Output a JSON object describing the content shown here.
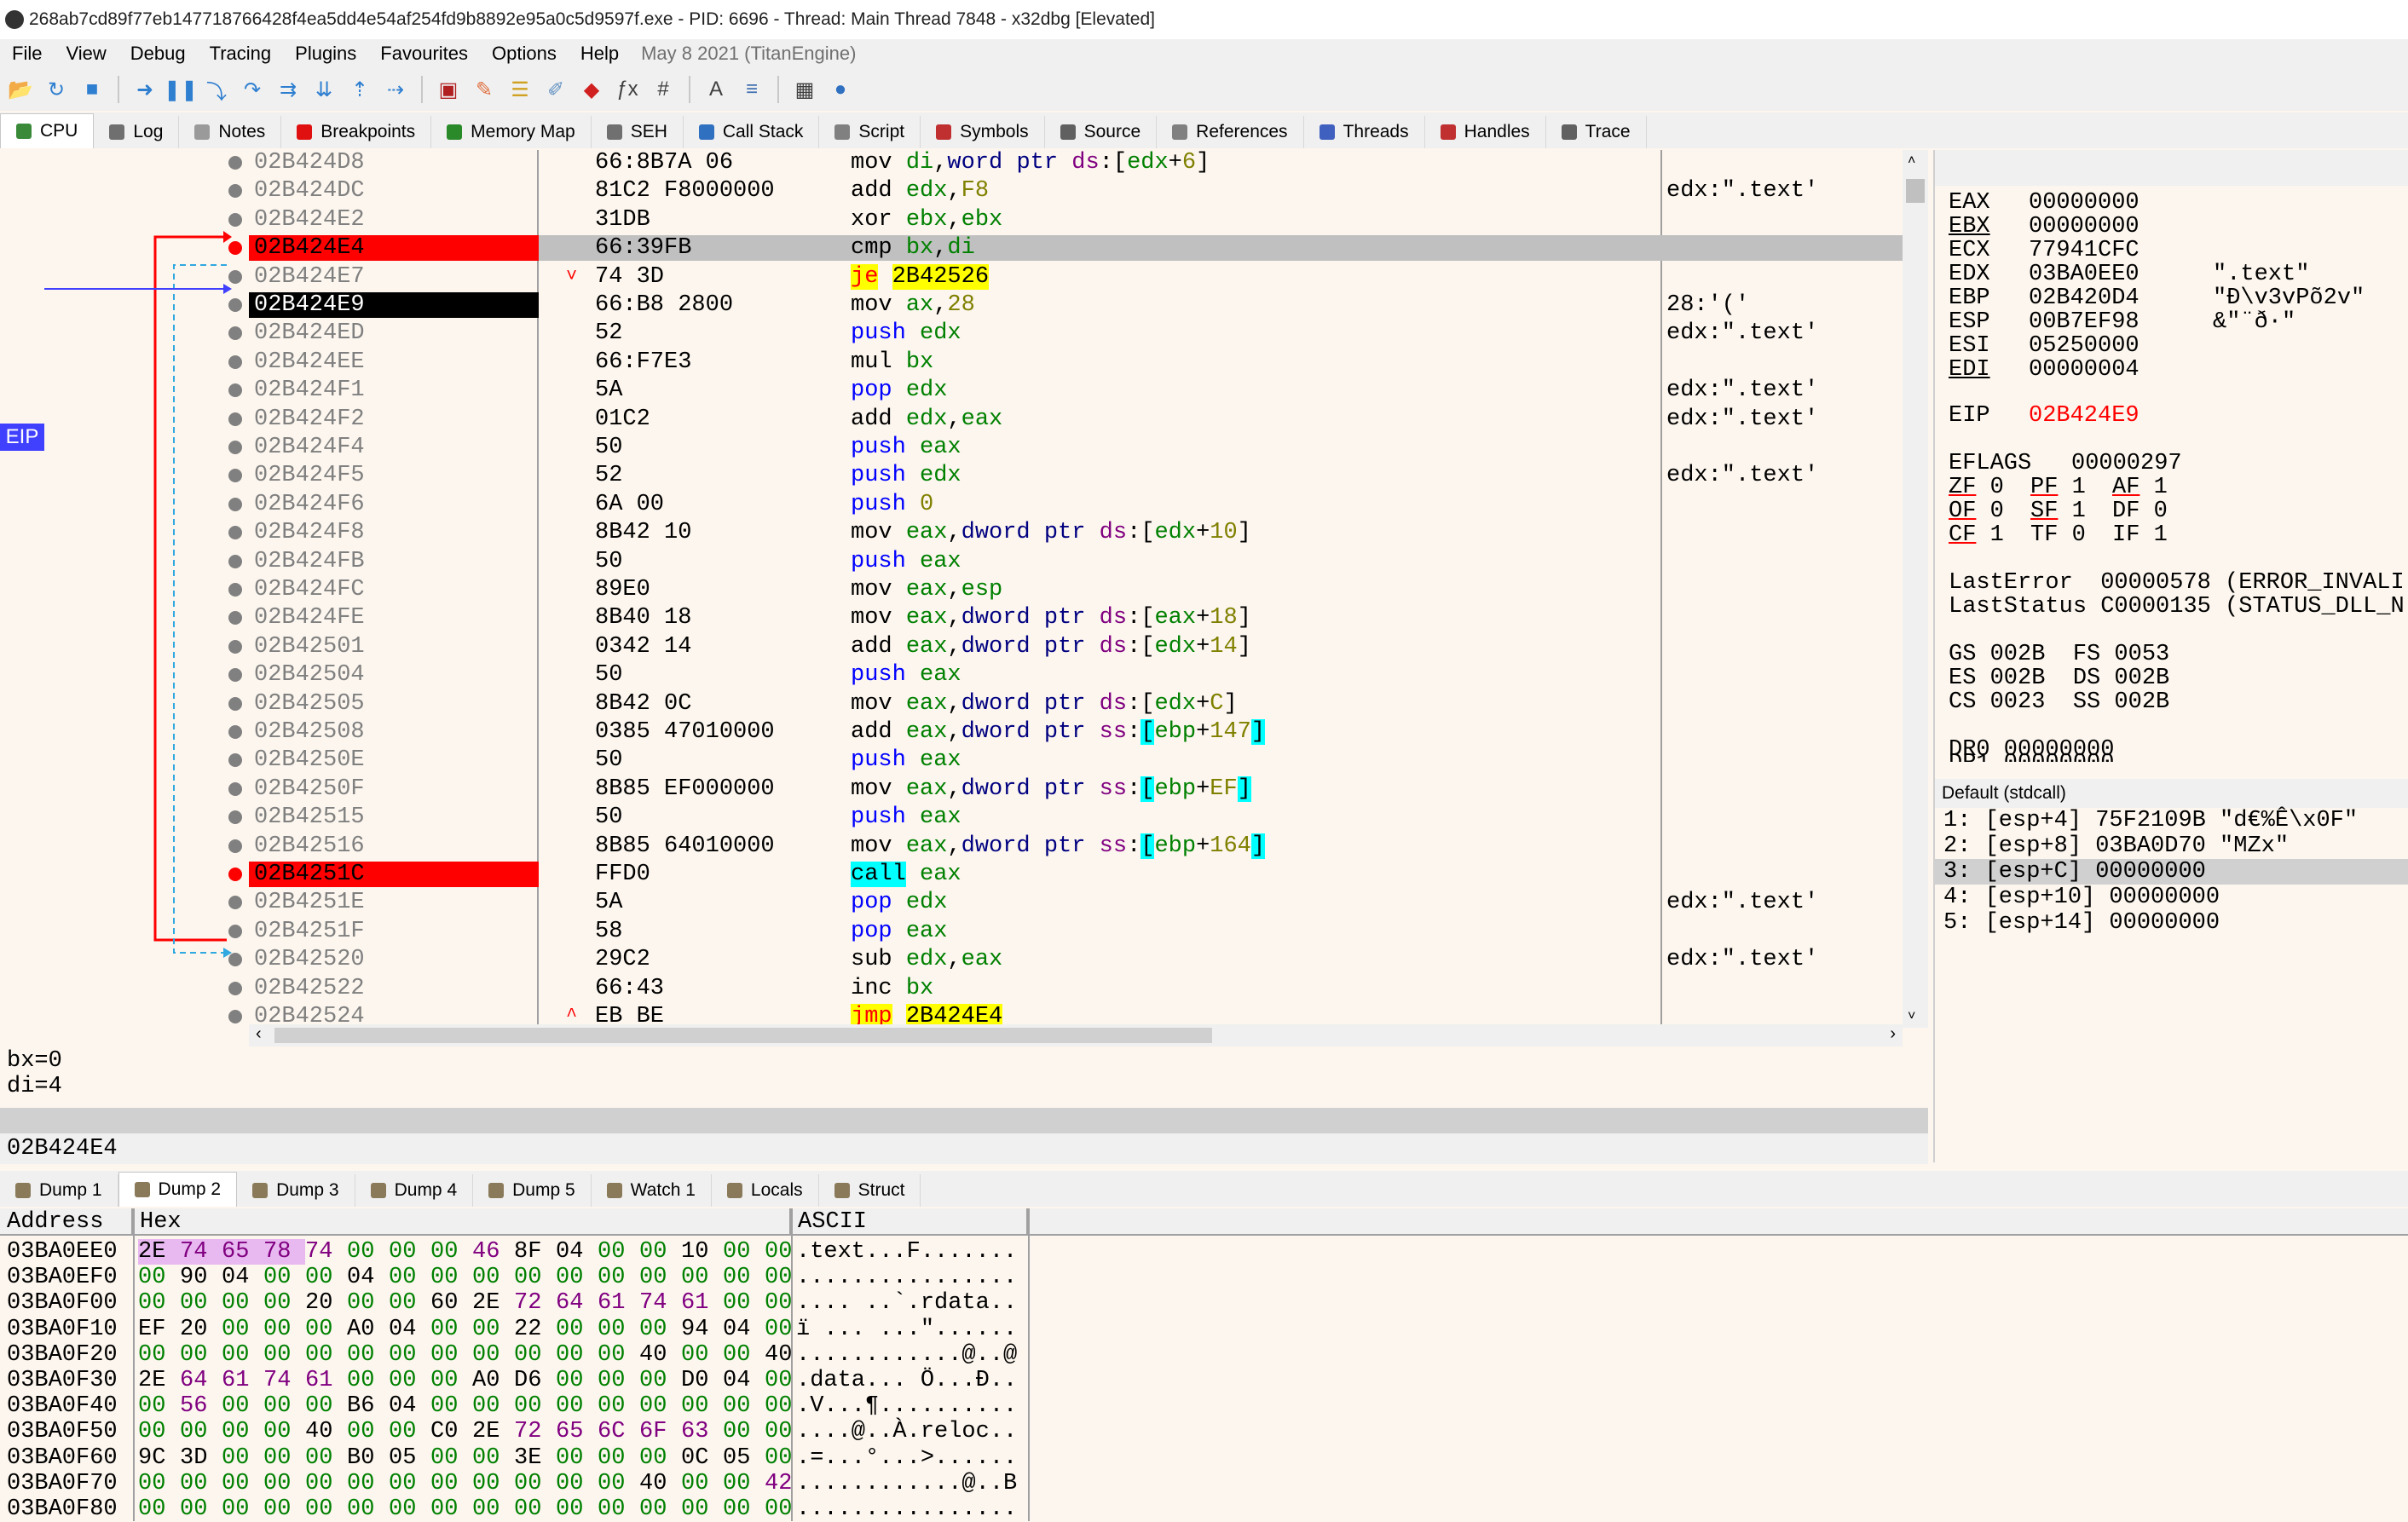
{
  "window": {
    "title": "268ab7cd89f77eb147718766428f4ea5dd4e54af254fd9b8892e95a0c5d9597f.exe - PID: 6696 - Thread: Main Thread 7848 - x32dbg [Elevated]"
  },
  "menu": {
    "items": [
      "File",
      "View",
      "Debug",
      "Tracing",
      "Plugins",
      "Favourites",
      "Options",
      "Help"
    ],
    "build": "May 8 2021 (TitanEngine)"
  },
  "toolbar": {
    "icons": [
      "open-icon",
      "restart-icon",
      "stop-icon",
      "run-icon",
      "pause-icon",
      "step-into-icon",
      "step-over-icon",
      "trace-into-icon",
      "trace-over-icon",
      "execute-till-return-icon",
      "run-to-user-code-icon",
      "scylla-icon",
      "patch-icon",
      "comments-icon",
      "labels-icon",
      "bookmarks-icon",
      "functions-icon",
      "variables-icon",
      "font-icon",
      "strings-icon",
      "calculator-icon",
      "help-icon"
    ]
  },
  "tabs": [
    {
      "label": "CPU",
      "icon": "cpu-icon",
      "color": "#3a8a3a"
    },
    {
      "label": "Log",
      "icon": "log-icon",
      "color": "#6f6f6f"
    },
    {
      "label": "Notes",
      "icon": "notes-icon",
      "color": "#9a9a9a"
    },
    {
      "label": "Breakpoints",
      "icon": "breakpoint-icon",
      "color": "#e01010"
    },
    {
      "label": "Memory Map",
      "icon": "memory-map-icon",
      "color": "#2a8a2a"
    },
    {
      "label": "SEH",
      "icon": "seh-icon",
      "color": "#707070"
    },
    {
      "label": "Call Stack",
      "icon": "call-stack-icon",
      "color": "#3070c0"
    },
    {
      "label": "Script",
      "icon": "script-icon",
      "color": "#808080"
    },
    {
      "label": "Symbols",
      "icon": "symbols-icon",
      "color": "#c03030"
    },
    {
      "label": "Source",
      "icon": "source-icon",
      "color": "#606060"
    },
    {
      "label": "References",
      "icon": "references-icon",
      "color": "#808080"
    },
    {
      "label": "Threads",
      "icon": "threads-icon",
      "color": "#4060c0"
    },
    {
      "label": "Handles",
      "icon": "handles-icon",
      "color": "#c03030"
    },
    {
      "label": "Trace",
      "icon": "trace-icon",
      "color": "#606060"
    }
  ],
  "eip_label": "EIP",
  "disasm": [
    {
      "addr": "02B424D8",
      "bytes": "66:8B7A 06",
      "instr": "mov di,word ptr ds:[edx+6]",
      "comment": ""
    },
    {
      "addr": "02B424DC",
      "bytes": "81C2 F8000000",
      "instr": "add edx,F8",
      "comment": "edx:\".text'"
    },
    {
      "addr": "02B424E2",
      "bytes": "31DB",
      "instr": "xor ebx,ebx",
      "comment": ""
    },
    {
      "addr": "02B424E4",
      "bytes": "66:39FB",
      "instr": "cmp bx,di",
      "comment": "",
      "bp": true,
      "selected": true
    },
    {
      "addr": "02B424E7",
      "bytes": "74 3D",
      "instr": "je 2B42526",
      "comment": "",
      "jmark": "˅",
      "jcc": true
    },
    {
      "addr": "02B424E9",
      "bytes": "66:B8 2800",
      "instr": "mov ax,28",
      "comment": "28:'('",
      "eip": true
    },
    {
      "addr": "02B424ED",
      "bytes": "52",
      "instr": "push edx",
      "comment": "edx:\".text'"
    },
    {
      "addr": "02B424EE",
      "bytes": "66:F7E3",
      "instr": "mul bx",
      "comment": ""
    },
    {
      "addr": "02B424F1",
      "bytes": "5A",
      "instr": "pop edx",
      "comment": "edx:\".text'"
    },
    {
      "addr": "02B424F2",
      "bytes": "01C2",
      "instr": "add edx,eax",
      "comment": "edx:\".text'"
    },
    {
      "addr": "02B424F4",
      "bytes": "50",
      "instr": "push eax",
      "comment": ""
    },
    {
      "addr": "02B424F5",
      "bytes": "52",
      "instr": "push edx",
      "comment": "edx:\".text'"
    },
    {
      "addr": "02B424F6",
      "bytes": "6A 00",
      "instr": "push 0",
      "comment": ""
    },
    {
      "addr": "02B424F8",
      "bytes": "8B42 10",
      "instr": "mov eax,dword ptr ds:[edx+10]",
      "comment": ""
    },
    {
      "addr": "02B424FB",
      "bytes": "50",
      "instr": "push eax",
      "comment": ""
    },
    {
      "addr": "02B424FC",
      "bytes": "89E0",
      "instr": "mov eax,esp",
      "comment": ""
    },
    {
      "addr": "02B424FE",
      "bytes": "8B40 18",
      "instr": "mov eax,dword ptr ds:[eax+18]",
      "comment": ""
    },
    {
      "addr": "02B42501",
      "bytes": "0342 14",
      "instr": "add eax,dword ptr ds:[edx+14]",
      "comment": ""
    },
    {
      "addr": "02B42504",
      "bytes": "50",
      "instr": "push eax",
      "comment": ""
    },
    {
      "addr": "02B42505",
      "bytes": "8B42 0C",
      "instr": "mov eax,dword ptr ds:[edx+C]",
      "comment": ""
    },
    {
      "addr": "02B42508",
      "bytes": "0385 47010000",
      "instr": "add eax,dword ptr ss:[ebp+147]",
      "comment": ""
    },
    {
      "addr": "02B4250E",
      "bytes": "50",
      "instr": "push eax",
      "comment": ""
    },
    {
      "addr": "02B4250F",
      "bytes": "8B85 EF000000",
      "instr": "mov eax,dword ptr ss:[ebp+EF]",
      "comment": ""
    },
    {
      "addr": "02B42515",
      "bytes": "50",
      "instr": "push eax",
      "comment": ""
    },
    {
      "addr": "02B42516",
      "bytes": "8B85 64010000",
      "instr": "mov eax,dword ptr ss:[ebp+164]",
      "comment": ""
    },
    {
      "addr": "02B4251C",
      "bytes": "FFD0",
      "instr": "call eax",
      "comment": "",
      "bp": true,
      "call": true
    },
    {
      "addr": "02B4251E",
      "bytes": "5A",
      "instr": "pop edx",
      "comment": "edx:\".text'"
    },
    {
      "addr": "02B4251F",
      "bytes": "58",
      "instr": "pop eax",
      "comment": ""
    },
    {
      "addr": "02B42520",
      "bytes": "29C2",
      "instr": "sub edx,eax",
      "comment": "edx:\".text'"
    },
    {
      "addr": "02B42522",
      "bytes": "66:43",
      "instr": "inc bx",
      "comment": ""
    },
    {
      "addr": "02B42524",
      "bytes": "EB BE",
      "instr": "jmp 2B424E4",
      "comment": "",
      "jmark": "^",
      "jcc": true
    },
    {
      "addr": "02B42526",
      "bytes": "6A 00",
      "instr": "push 0",
      "comment": ""
    },
    {
      "addr": "02B42528",
      "bytes": "6A 04",
      "instr": "push 4",
      "comment": ""
    },
    {
      "addr": "02B4252A",
      "bytes": "89E0",
      "instr": "mov eax,esp",
      "comment": ""
    }
  ],
  "registers": {
    "general": [
      {
        "name": "EAX",
        "value": "00000000",
        "extra": ""
      },
      {
        "name": "EBX",
        "value": "00000000",
        "extra": "",
        "style": "uline"
      },
      {
        "name": "ECX",
        "value": "77941CFC",
        "extra": ""
      },
      {
        "name": "EDX",
        "value": "03BA0EE0",
        "extra": "\".text\""
      },
      {
        "name": "EBP",
        "value": "02B420D4",
        "extra": "\"Đ\\v3vPõ2v\""
      },
      {
        "name": "ESP",
        "value": "00B7EF98",
        "extra": "&\"¨ð·\""
      },
      {
        "name": "ESI",
        "value": "05250000",
        "extra": ""
      },
      {
        "name": "EDI",
        "value": "00000004",
        "extra": "",
        "style": "uline"
      }
    ],
    "eip": {
      "name": "EIP",
      "value": "02B424E9"
    },
    "eflags": {
      "name": "EFLAGS",
      "value": "00000297"
    },
    "flags_rows": [
      [
        {
          "n": "ZF",
          "v": "0",
          "u": "ured"
        },
        {
          "n": "PF",
          "v": "1",
          "u": "ured"
        },
        {
          "n": "AF",
          "v": "1",
          "u": "ured"
        }
      ],
      [
        {
          "n": "OF",
          "v": "0",
          "u": "ured"
        },
        {
          "n": "SF",
          "v": "1",
          "u": "ured"
        },
        {
          "n": "DF",
          "v": "0",
          "u": ""
        }
      ],
      [
        {
          "n": "CF",
          "v": "1",
          "u": "ured"
        },
        {
          "n": "TF",
          "v": "0",
          "u": ""
        },
        {
          "n": "IF",
          "v": "1",
          "u": ""
        }
      ]
    ],
    "last_error": "LastError  00000578 (ERROR_INVALI",
    "last_status": "LastStatus C0000135 (STATUS_DLL_N",
    "segments": [
      "GS 002B  FS 0053",
      "ES 002B  DS 002B",
      "CS 0023  SS 002B"
    ],
    "dr0": "DR0 00000000",
    "dr1_partial": "DR1 00000000"
  },
  "args": {
    "header": "Default (stdcall)",
    "rows": [
      "1: [esp+4] 75F2109B \"d€%Ê\\x0F\"",
      "2: [esp+8] 03BA0D70 \"MZx\"",
      "3: [esp+C] 00000000",
      "4: [esp+10] 00000000",
      "5: [esp+14] 00000000"
    ],
    "selected_index": 2
  },
  "info": {
    "lines": [
      "bx=0",
      "di=4"
    ],
    "address": "02B424E4"
  },
  "dump_tabs": [
    {
      "label": "Dump 1",
      "icon": "dump-icon"
    },
    {
      "label": "Dump 2",
      "icon": "dump-icon"
    },
    {
      "label": "Dump 3",
      "icon": "dump-icon"
    },
    {
      "label": "Dump 4",
      "icon": "dump-icon"
    },
    {
      "label": "Dump 5",
      "icon": "dump-icon"
    },
    {
      "label": "Watch 1",
      "icon": "watch-icon"
    },
    {
      "label": "Locals",
      "icon": "locals-icon"
    },
    {
      "label": "Struct",
      "icon": "struct-icon"
    }
  ],
  "dump": {
    "headers": {
      "address": "Address",
      "hex": "Hex",
      "ascii": "ASCII"
    },
    "rows": [
      {
        "addr": "03BA0EE0",
        "hex": "2E 74 65 78 74 00 00 00 46 8F 04 00 00 10 00 00",
        "ascii": ".text...F......."
      },
      {
        "addr": "03BA0EF0",
        "hex": "00 90 04 00 00 04 00 00 00 00 00 00 00 00 00 00",
        "ascii": "................"
      },
      {
        "addr": "03BA0F00",
        "hex": "00 00 00 00 20 00 00 60 2E 72 64 61 74 61 00 00",
        "ascii": ".... ..`.rdata.."
      },
      {
        "addr": "03BA0F10",
        "hex": "EF 20 00 00 00 A0 04 00 00 22 00 00 00 94 04 00",
        "ascii": "ï ... ...\"......"
      },
      {
        "addr": "03BA0F20",
        "hex": "00 00 00 00 00 00 00 00 00 00 00 00 40 00 00 40",
        "ascii": "............@..@"
      },
      {
        "addr": "03BA0F30",
        "hex": "2E 64 61 74 61 00 00 00 A0 D6 00 00 00 D0 04 00",
        "ascii": ".data... Ö...Ð.."
      },
      {
        "addr": "03BA0F40",
        "hex": "00 56 00 00 00 B6 04 00 00 00 00 00 00 00 00 00",
        "ascii": ".V...¶.........."
      },
      {
        "addr": "03BA0F50",
        "hex": "00 00 00 00 40 00 00 C0 2E 72 65 6C 6F 63 00 00",
        "ascii": "....@..À.reloc.."
      },
      {
        "addr": "03BA0F60",
        "hex": "9C 3D 00 00 00 B0 05 00 00 3E 00 00 00 0C 05 00",
        "ascii": ".=...°...>......"
      },
      {
        "addr": "03BA0F70",
        "hex": "00 00 00 00 00 00 00 00 00 00 00 00 40 00 00 42",
        "ascii": "............@..B"
      },
      {
        "addr": "03BA0F80",
        "hex": "00 00 00 00 00 00 00 00 00 00 00 00 00 00 00 00",
        "ascii": "................"
      }
    ]
  }
}
